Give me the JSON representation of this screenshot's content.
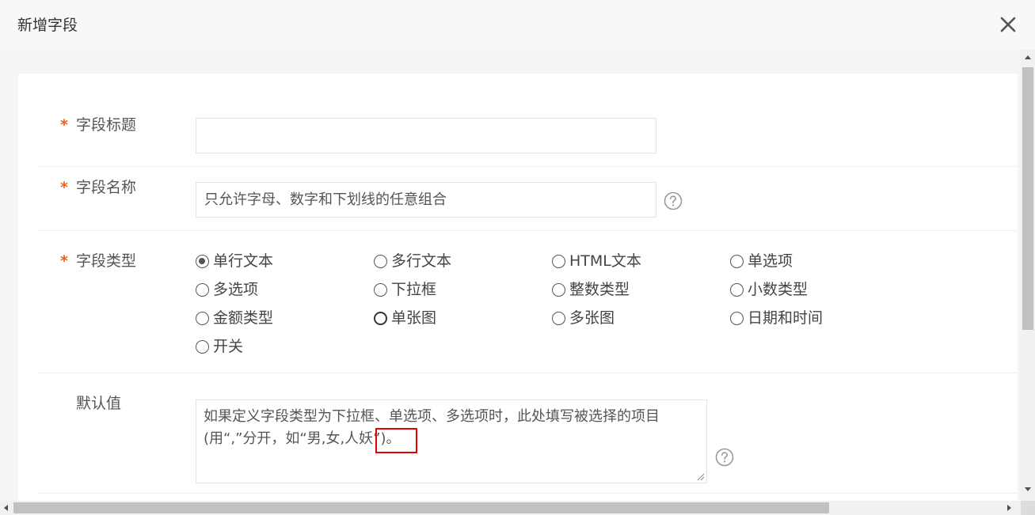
{
  "dialog": {
    "title": "新增字段",
    "close_icon": "close-x-icon"
  },
  "form": {
    "field_title": {
      "required_mark": "*",
      "label": "字段标题",
      "value": "",
      "placeholder": ""
    },
    "field_name": {
      "required_mark": "*",
      "label": "字段名称",
      "value": "",
      "placeholder": "只允许字母、数字和下划线的任意组合",
      "help_icon": "question-circle-icon"
    },
    "field_type": {
      "required_mark": "*",
      "label": "字段类型",
      "selected": "单行文本",
      "options": [
        {
          "label": "单行文本",
          "checked": true
        },
        {
          "label": "多行文本",
          "checked": false
        },
        {
          "label": "HTML文本",
          "checked": false
        },
        {
          "label": "单选项",
          "checked": false
        },
        {
          "label": "多选项",
          "checked": false
        },
        {
          "label": "下拉框",
          "checked": false
        },
        {
          "label": "整数类型",
          "checked": false
        },
        {
          "label": "小数类型",
          "checked": false
        },
        {
          "label": "金额类型",
          "checked": false
        },
        {
          "label": "单张图",
          "checked": false
        },
        {
          "label": "多张图",
          "checked": false
        },
        {
          "label": "日期和时间",
          "checked": false
        },
        {
          "label": "开关",
          "checked": false
        }
      ]
    },
    "default_value": {
      "label": "默认值",
      "value": "",
      "placeholder": "如果定义字段类型为下拉框、单选项、多选项时，此处填写被选择的项目(用“,”分开，如“男,女,人妖”)。",
      "help_icon": "question-circle-icon"
    }
  },
  "colors": {
    "required": "#e8641b",
    "highlight": "#e60000"
  }
}
